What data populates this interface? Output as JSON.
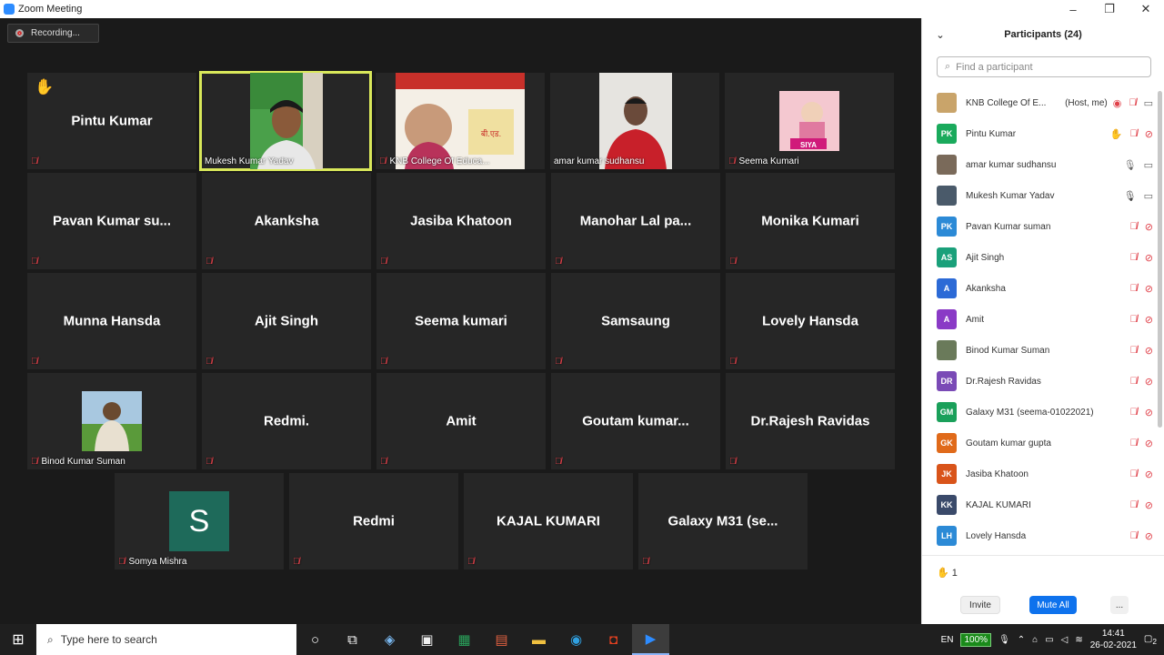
{
  "window": {
    "title": "Zoom Meeting",
    "minimize": "–",
    "maximize": "❐",
    "close": "✕"
  },
  "recording": {
    "label": "Recording..."
  },
  "tiles": [
    {
      "id": "t0",
      "name": "Pintu Kumar",
      "footer": "",
      "hand": true
    },
    {
      "id": "t1",
      "name": "",
      "footer": "Mukesh Kumar Yadav",
      "active": true
    },
    {
      "id": "t2",
      "name": "",
      "footer": "KNB College Of Educa..."
    },
    {
      "id": "t3",
      "name": "",
      "footer": "amar kumar sudhansu"
    },
    {
      "id": "t4",
      "name": "",
      "footer": "Seema Kumari"
    },
    {
      "id": "t5",
      "name": "Pavan Kumar su..."
    },
    {
      "id": "t6",
      "name": "Akanksha"
    },
    {
      "id": "t7",
      "name": "Jasiba Khatoon"
    },
    {
      "id": "t8",
      "name": "Manohar Lal pa..."
    },
    {
      "id": "t9",
      "name": "Monika Kumari"
    },
    {
      "id": "t10",
      "name": "Munna Hansda"
    },
    {
      "id": "t11",
      "name": "Ajit Singh"
    },
    {
      "id": "t12",
      "name": "Seema kumari"
    },
    {
      "id": "t13",
      "name": "Samsaung"
    },
    {
      "id": "t14",
      "name": "Lovely Hansda"
    },
    {
      "id": "t15",
      "name": "",
      "footer": "Binod Kumar Suman"
    },
    {
      "id": "t16",
      "name": "Redmi."
    },
    {
      "id": "t17",
      "name": "Amit"
    },
    {
      "id": "t18",
      "name": "Goutam kumar..."
    },
    {
      "id": "t19",
      "name": "Dr.Rajesh Ravidas"
    },
    {
      "id": "t20",
      "name": "",
      "footer": "Somya Mishra",
      "initial": "S"
    },
    {
      "id": "t21",
      "name": "Redmi"
    },
    {
      "id": "t22",
      "name": "KAJAL KUMARI"
    },
    {
      "id": "t23",
      "name": "Galaxy M31 (se..."
    }
  ],
  "tile_media": {
    "siya_text": "SIYA",
    "banner_text": "बी.एड."
  },
  "panel": {
    "title": "Participants (24)",
    "search_placeholder": "Find a participant",
    "participants": [
      {
        "name": "KNB College Of E...",
        "suffix": "(Host, me)",
        "initials": "",
        "color": "#c9a46a",
        "mic": "muted",
        "cam": "on",
        "rec": true
      },
      {
        "name": "Pintu Kumar",
        "initials": "PK",
        "color": "#1aaa5c",
        "mic": "muted",
        "cam": "off",
        "hand": true
      },
      {
        "name": "amar kumar sudhansu",
        "initials": "",
        "color": "#7a6a5a",
        "mic": "on",
        "cam": "on"
      },
      {
        "name": "Mukesh Kumar Yadav",
        "initials": "",
        "color": "#4a5a6a",
        "mic": "on-active",
        "cam": "on"
      },
      {
        "name": "Pavan Kumar suman",
        "initials": "PK",
        "color": "#2c8ad6",
        "mic": "muted",
        "cam": "off"
      },
      {
        "name": "Ajit Singh",
        "initials": "AS",
        "color": "#1aa07a",
        "mic": "muted",
        "cam": "off"
      },
      {
        "name": "Akanksha",
        "initials": "A",
        "color": "#2c6ad6",
        "mic": "muted",
        "cam": "off"
      },
      {
        "name": "Amit",
        "initials": "A",
        "color": "#8a3ac6",
        "mic": "muted",
        "cam": "off"
      },
      {
        "name": "Binod Kumar Suman",
        "initials": "",
        "color": "#6a7a5a",
        "mic": "muted",
        "cam": "off"
      },
      {
        "name": "Dr.Rajesh Ravidas",
        "initials": "DR",
        "color": "#7a4ab6",
        "mic": "muted",
        "cam": "off"
      },
      {
        "name": "Galaxy M31 (seema-01022021)",
        "initials": "GM",
        "color": "#1aa05a",
        "mic": "muted",
        "cam": "off"
      },
      {
        "name": "Goutam kumar gupta",
        "initials": "GK",
        "color": "#e06a1a",
        "mic": "muted",
        "cam": "off"
      },
      {
        "name": "Jasiba Khatoon",
        "initials": "JK",
        "color": "#d9541a",
        "mic": "muted",
        "cam": "off"
      },
      {
        "name": "KAJAL KUMARI",
        "initials": "KK",
        "color": "#3a4a6a",
        "mic": "muted",
        "cam": "off"
      },
      {
        "name": "Lovely Hansda",
        "initials": "LH",
        "color": "#2c8ad6",
        "mic": "muted",
        "cam": "off"
      }
    ],
    "hand_count": "1",
    "invite_label": "Invite",
    "mute_all_label": "Mute All",
    "more_label": "..."
  },
  "taskbar": {
    "search_placeholder": "Type here to search",
    "lang": "EN",
    "battery": "100%",
    "time": "14:41",
    "date": "26-02-2021",
    "notif_count": "2"
  }
}
